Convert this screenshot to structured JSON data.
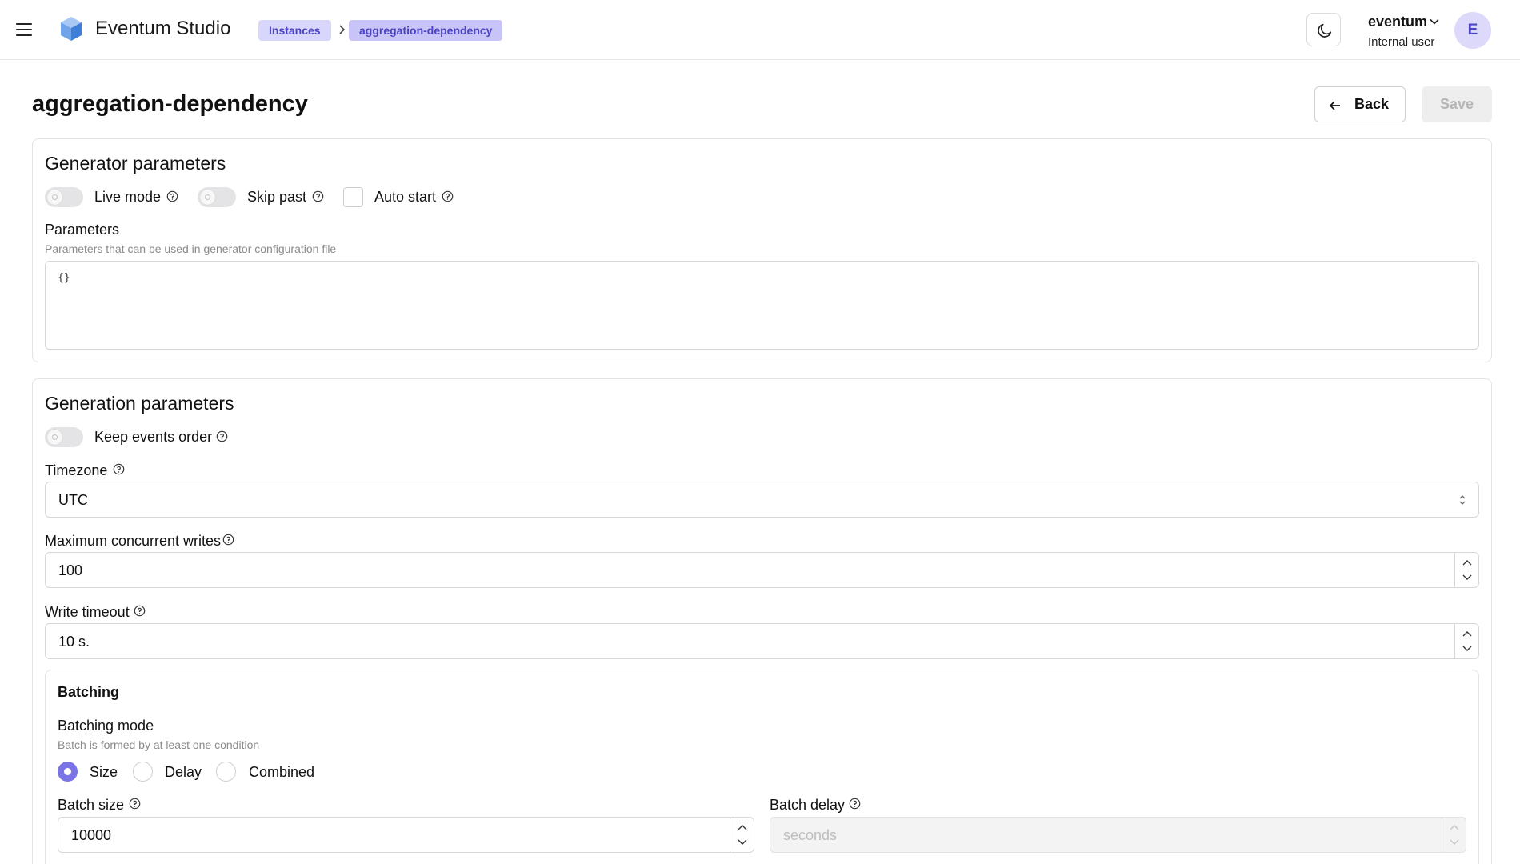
{
  "header": {
    "app_title": "Eventum Studio",
    "breadcrumbs": [
      "Instances",
      "aggregation-dependency"
    ],
    "user": {
      "name": "eventum",
      "role": "Internal user",
      "avatar_initial": "E"
    },
    "icons": [
      "menu-icon",
      "cube-logo-icon",
      "chevron-right-icon",
      "moon-icon",
      "chevron-down-icon"
    ]
  },
  "page": {
    "title": "aggregation-dependency",
    "back_label": "Back",
    "save_label": "Save"
  },
  "generator_parameters": {
    "title": "Generator parameters",
    "live_mode": {
      "label": "Live mode",
      "enabled": false
    },
    "skip_past": {
      "label": "Skip past",
      "enabled": false
    },
    "auto_start": {
      "label": "Auto start",
      "checked": false
    },
    "parameters": {
      "label": "Parameters",
      "description": "Parameters that can be used in generator configuration file",
      "value": "{}"
    }
  },
  "generation_parameters": {
    "title": "Generation parameters",
    "keep_events_order": {
      "label": "Keep events order",
      "enabled": false
    },
    "timezone": {
      "label": "Timezone",
      "value": "UTC"
    },
    "max_concurrent_writes": {
      "label": "Maximum concurrent writes",
      "value": "100"
    },
    "write_timeout": {
      "label": "Write timeout",
      "value": "10 s."
    },
    "batching": {
      "title": "Batching",
      "mode_label": "Batching mode",
      "mode_description": "Batch is formed by at least one condition",
      "modes": [
        "Size",
        "Delay",
        "Combined"
      ],
      "selected_mode": "Size",
      "batch_size": {
        "label": "Batch size",
        "value": "10000"
      },
      "batch_delay": {
        "label": "Batch delay",
        "placeholder": "seconds"
      }
    }
  },
  "colors": {
    "accent": "#7b74e6",
    "breadcrumb_bg": "#d9d6fb",
    "breadcrumb_text": "#4c44c4"
  }
}
